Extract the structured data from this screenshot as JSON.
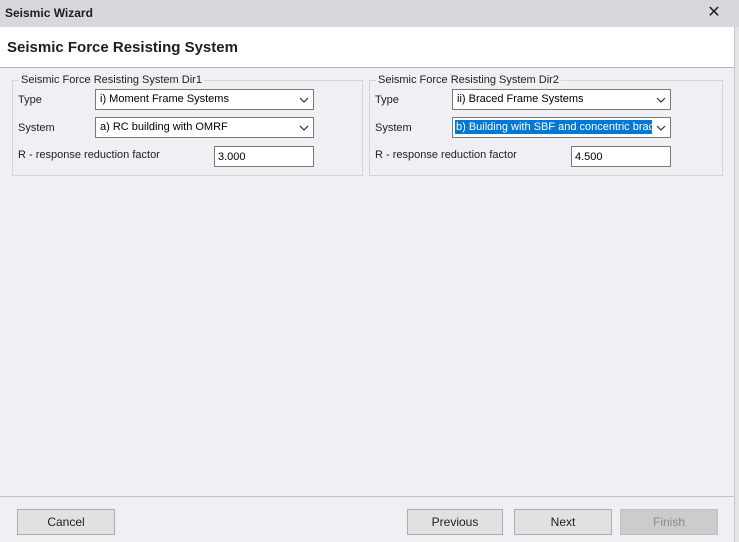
{
  "window": {
    "title": "Seismic Wizard",
    "close_glyph": "✕"
  },
  "page": {
    "title": "Seismic Force Resisting System"
  },
  "dir1": {
    "legend": "Seismic Force Resisting System  Dir1",
    "type_label": "Type",
    "type_value": "i) Moment Frame Systems",
    "system_label": "System",
    "system_value": "a) RC building with OMRF",
    "r_label": "R - response reduction factor",
    "r_value": "3.000"
  },
  "dir2": {
    "legend": "Seismic Force Resisting System  Dir2",
    "type_label": "Type",
    "type_value": "ii) Braced Frame Systems",
    "system_label": "System",
    "system_value": "b) Building with SBF and concentric brac",
    "r_label": "R - response reduction factor",
    "r_value": "4.500"
  },
  "buttons": {
    "cancel": "Cancel",
    "previous": "Previous",
    "next": "Next",
    "finish": "Finish"
  },
  "colors": {
    "selection": "#0078d7",
    "titlebar": "#d8d8dc",
    "panel": "#f0eff4"
  }
}
